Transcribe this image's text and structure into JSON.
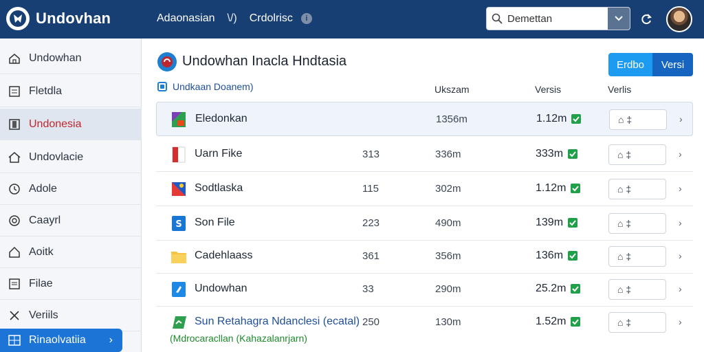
{
  "header": {
    "brand": "Undovhan",
    "nav": [
      "Adaonasian",
      "\\/)",
      "Crdolrisc"
    ],
    "info_icon": "info-icon",
    "search_value": "Demettan",
    "search_placeholder": "Demettan",
    "colors": {
      "topbar": "#173f73",
      "accent": "#1d9bf0"
    }
  },
  "sidebar": {
    "items": [
      {
        "label": "Undowhan",
        "icon": "home-icon"
      },
      {
        "label": "Fletdla",
        "icon": "document-icon"
      },
      {
        "label": "Undonesia",
        "icon": "panel-icon",
        "active": true
      },
      {
        "label": "Undovlacie",
        "icon": "house-icon"
      },
      {
        "label": "Adole",
        "icon": "clock-icon"
      },
      {
        "label": "Caayrl",
        "icon": "settings-icon"
      },
      {
        "label": "Aoitk",
        "icon": "house-icon"
      },
      {
        "label": "Filae",
        "icon": "list-icon"
      },
      {
        "label": "Veriils",
        "icon": "tools-icon"
      },
      {
        "label": "Rinaolvatiia",
        "icon": "grid-icon",
        "active": true
      }
    ]
  },
  "main": {
    "title": "Undowhan Inacla Hndtasia",
    "segment": {
      "a": "Erdbo",
      "b": "Versi"
    },
    "checkbox_label": "Undkaan Doanem)",
    "columns": [
      "Ukszam",
      "Versis",
      "Verlis"
    ],
    "rows": [
      {
        "name": "Eledonkan",
        "c1": "",
        "c2": "1356m",
        "c3": "1.12m",
        "highlight": true,
        "icon": "image-file-icon"
      },
      {
        "name": "Uarn Fike",
        "c1": "313",
        "c2": "336m",
        "c3": "333m",
        "icon": "pdf-file-icon"
      },
      {
        "name": "Sodtlaska",
        "c1": "115",
        "c2": "302m",
        "c3": "1.12m",
        "icon": "image-file-icon"
      },
      {
        "name": "Son File",
        "c1": "223",
        "c2": "490m",
        "c3": "139m",
        "icon": "doc-file-icon"
      },
      {
        "name": "Cadehlaass",
        "c1": "361",
        "c2": "356m",
        "c3": "136m",
        "icon": "folder-icon"
      },
      {
        "name": "Undowhan",
        "c1": "33",
        "c2": "290m",
        "c3": "25.2m",
        "icon": "app-file-icon"
      },
      {
        "name": "Sun Retahagra Ndanclesi (ecatal)",
        "c1": "250",
        "c2": "130m",
        "c3": "1.52m",
        "icon": "green-file-icon",
        "green": true
      }
    ],
    "footer_note": "(Mdrocaracllan (Kahazalanrjarn)",
    "action_text": "⌂ ‡"
  }
}
